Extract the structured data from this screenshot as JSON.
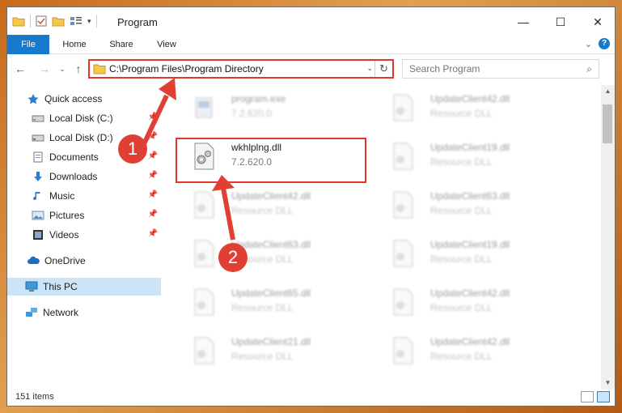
{
  "window": {
    "title": "Program",
    "minimize_glyph": "—",
    "maximize_glyph": "☐",
    "close_glyph": "✕"
  },
  "ribbon": {
    "tabs": [
      "File",
      "Home",
      "Share",
      "View"
    ],
    "expand_glyph": "⌄",
    "help_glyph": "?"
  },
  "nav": {
    "back_glyph": "←",
    "forward_glyph": "→",
    "recent_glyph": "⌄",
    "up_glyph": "↑",
    "address": "C:\\Program Files\\Program Directory",
    "address_dropdown_glyph": "⌄",
    "refresh_glyph": "↻",
    "search_placeholder": "Search Program",
    "search_icon_glyph": "⌕"
  },
  "sidebar": {
    "items": [
      {
        "label": "Quick access",
        "icon": "star-icon",
        "pinned": false
      },
      {
        "label": "Local Disk (C:)",
        "icon": "drive-icon",
        "pinned": true
      },
      {
        "label": "Local Disk (D:)",
        "icon": "drive-icon",
        "pinned": true
      },
      {
        "label": "Documents",
        "icon": "documents-icon",
        "pinned": true
      },
      {
        "label": "Downloads",
        "icon": "download-icon",
        "pinned": true
      },
      {
        "label": "Music",
        "icon": "music-icon",
        "pinned": true
      },
      {
        "label": "Pictures",
        "icon": "pictures-icon",
        "pinned": true
      },
      {
        "label": "Videos",
        "icon": "videos-icon",
        "pinned": true
      },
      {
        "label": "OneDrive",
        "icon": "cloud-icon",
        "pinned": false
      },
      {
        "label": "This PC",
        "icon": "computer-icon",
        "pinned": false,
        "selected": true
      },
      {
        "label": "Network",
        "icon": "network-icon",
        "pinned": false
      }
    ],
    "pin_glyph": "📌"
  },
  "files": [
    {
      "name": "program.exe",
      "sub": "7.2.620.0",
      "highlighted": false
    },
    {
      "name": "UpdateClient42.dll",
      "sub": "Resource DLL",
      "highlighted": false
    },
    {
      "name": "wkhlplng.dll",
      "sub": "7.2.620.0",
      "highlighted": true
    },
    {
      "name": "UpdateClient19.dll",
      "sub": "Resource DLL",
      "highlighted": false
    },
    {
      "name": "UpdateClient42.dll",
      "sub": "Resource DLL",
      "highlighted": false
    },
    {
      "name": "UpdateClient63.dll",
      "sub": "Resource DLL",
      "highlighted": false
    },
    {
      "name": "UpdateClient63.dll",
      "sub": "Resource DLL",
      "highlighted": false
    },
    {
      "name": "UpdateClient19.dll",
      "sub": "Resource DLL",
      "highlighted": false
    },
    {
      "name": "UpdateClient65.dll",
      "sub": "Resource DLL",
      "highlighted": false
    },
    {
      "name": "UpdateClient42.dll",
      "sub": "Resource DLL",
      "highlighted": false
    },
    {
      "name": "UpdateClient21.dll",
      "sub": "Resource DLL",
      "highlighted": false
    },
    {
      "name": "UpdateClient42.dll",
      "sub": "Resource DLL",
      "highlighted": false
    }
  ],
  "status": {
    "item_count": "151 items"
  },
  "annotations": {
    "callout_1": "1",
    "callout_2": "2",
    "color": "#e04034"
  },
  "colors": {
    "accent": "#1979ca",
    "highlight": "#e0362c",
    "selected_bg": "#cce4f7"
  }
}
